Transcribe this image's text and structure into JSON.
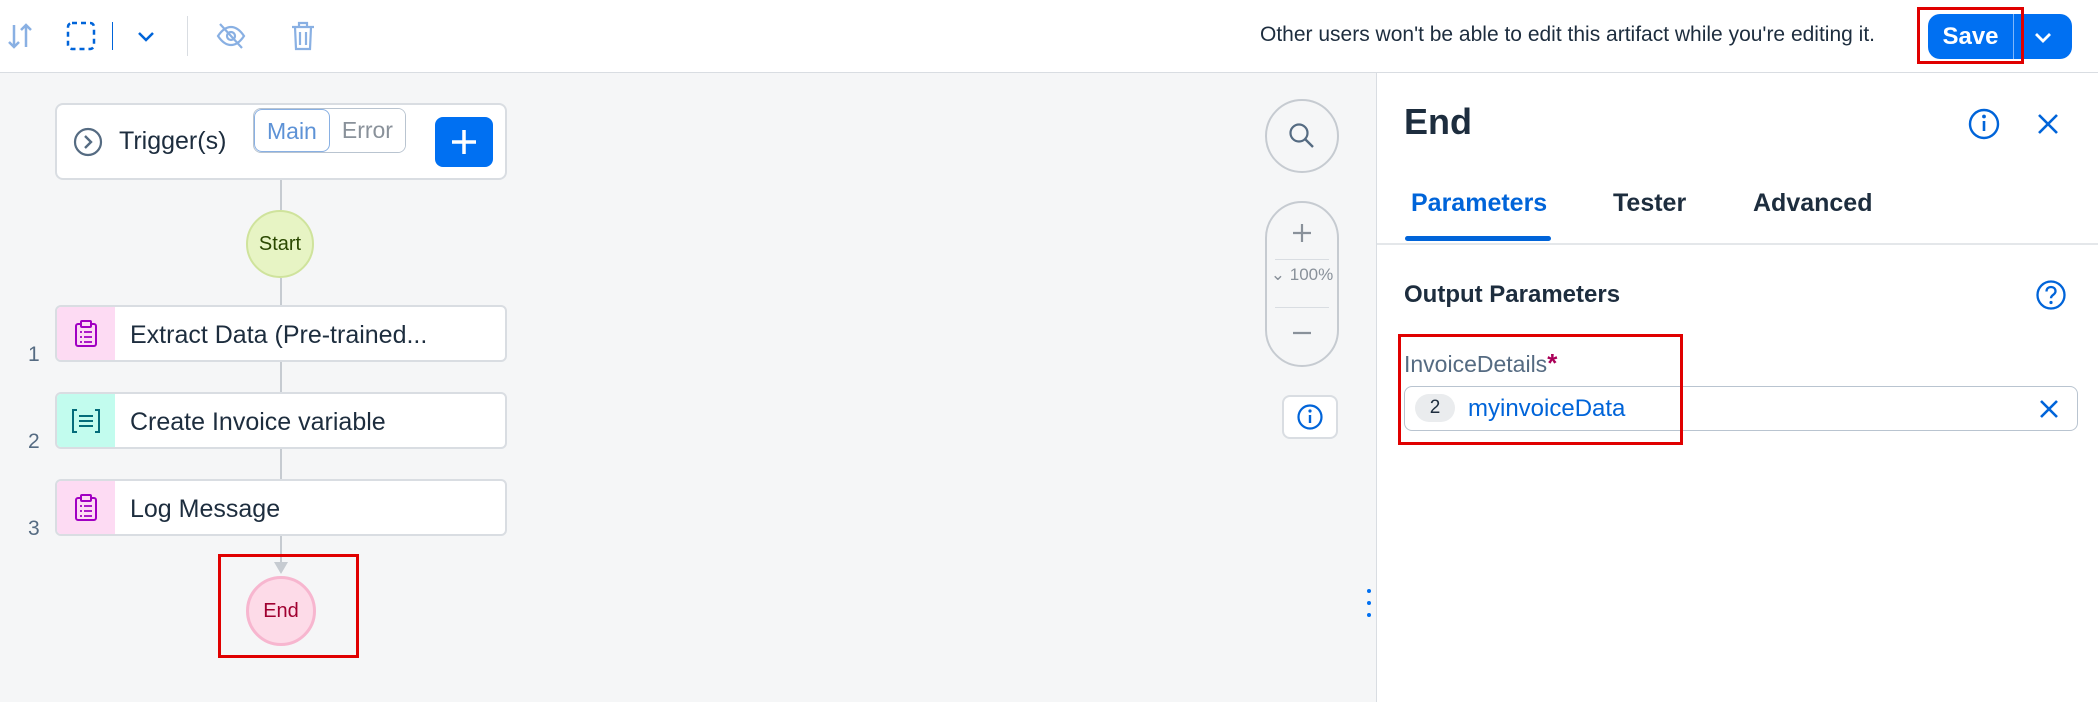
{
  "toolbar": {
    "notice": "Other users won't be able to edit this artifact while you're editing it.",
    "save_label": "Save"
  },
  "canvas": {
    "trigger": {
      "label": "Trigger(s)",
      "segments": [
        "Main",
        "Error"
      ]
    },
    "start_label": "Start",
    "steps": [
      {
        "num": "1",
        "label": "Extract Data (Pre-trained...",
        "icon": "clipboard-icon"
      },
      {
        "num": "2",
        "label": "Create Invoice variable",
        "icon": "list-variable-icon"
      },
      {
        "num": "3",
        "label": "Log Message",
        "icon": "clipboard-icon"
      }
    ],
    "end_label": "End",
    "zoom_level": "100%"
  },
  "panel": {
    "title": "End",
    "tabs": [
      "Parameters",
      "Tester",
      "Advanced"
    ],
    "active_tab": "Parameters",
    "section_title": "Output Parameters",
    "param_label": "InvoiceDetails",
    "required_marker": "*",
    "token_number": "2",
    "token_value": "myinvoiceData"
  },
  "colors": {
    "accent": "#0070f2",
    "highlight": "#e00000",
    "start_fill": "#e7f4c4",
    "end_fill": "#fddbe8"
  }
}
